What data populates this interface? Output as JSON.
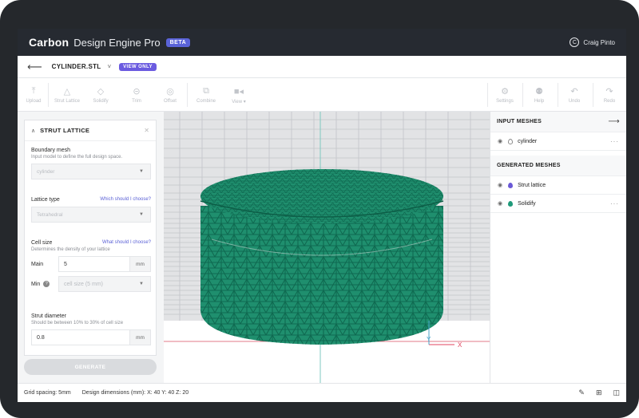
{
  "app": {
    "brand": "Carbon",
    "product": "Design Engine Pro",
    "badge": "BETA",
    "user_initial": "C",
    "user_name": "Craig Pinto"
  },
  "file": {
    "name": "CYLINDER.STL",
    "caret": "˅",
    "mode_badge": "VIEW ONLY"
  },
  "toolbar": {
    "left": [
      {
        "label": "Upload",
        "icon": "upload-icon",
        "glyph": "⤒"
      },
      {
        "label": "Strut Lattice",
        "icon": "lattice-icon",
        "glyph": "△"
      },
      {
        "label": "Solidify",
        "icon": "solidify-icon",
        "glyph": "◇"
      },
      {
        "label": "Trim",
        "icon": "trim-icon",
        "glyph": "⊝"
      },
      {
        "label": "Offset",
        "icon": "offset-icon",
        "glyph": "◎"
      },
      {
        "label": "Combine",
        "icon": "combine-icon",
        "glyph": "⧉"
      },
      {
        "label": "View ▾",
        "icon": "camera-icon",
        "glyph": "■◂"
      }
    ],
    "right": [
      {
        "label": "Settings",
        "icon": "gear-icon",
        "glyph": "⚙"
      },
      {
        "label": "Help",
        "icon": "help-icon",
        "glyph": "⚉"
      },
      {
        "label": "Undo",
        "icon": "undo-icon",
        "glyph": "↶"
      },
      {
        "label": "Redo",
        "icon": "redo-icon",
        "glyph": "↷"
      }
    ]
  },
  "panel": {
    "title": "STRUT LATTICE",
    "boundary": {
      "label": "Boundary mesh",
      "desc": "Input model to define the full design space.",
      "value": "cylinder"
    },
    "lattice": {
      "label": "Lattice type",
      "help": "Which should I choose?",
      "value": "Tetrahedral"
    },
    "cell": {
      "label": "Cell size",
      "help": "What should I choose?",
      "desc": "Determines the density of your lattice",
      "main_label": "Main",
      "main_value": "5",
      "unit": "mm",
      "min_label": "Min",
      "min_placeholder": "cell size (5 mm)"
    },
    "strut": {
      "label": "Strut diameter",
      "desc": "Should be between 10% to 30% of cell size",
      "value": "0.8",
      "unit": "mm"
    },
    "generate_label": "GENERATE"
  },
  "meshes": {
    "input_title": "INPUT MESHES",
    "input_items": [
      {
        "name": "cylinder"
      }
    ],
    "generated_title": "GENERATED MESHES",
    "generated_items": [
      {
        "name": "Strut lattice"
      },
      {
        "name": "Solidify"
      }
    ]
  },
  "viewport": {
    "axis_x": "X",
    "axis_y": "Y",
    "mesh_color": "#1f8f6e"
  },
  "status": {
    "grid": "Grid spacing: 5mm",
    "dims_label": "Design dimensions (mm):",
    "x": "X: 40",
    "y": "Y: 40",
    "z": "Z: 20"
  }
}
